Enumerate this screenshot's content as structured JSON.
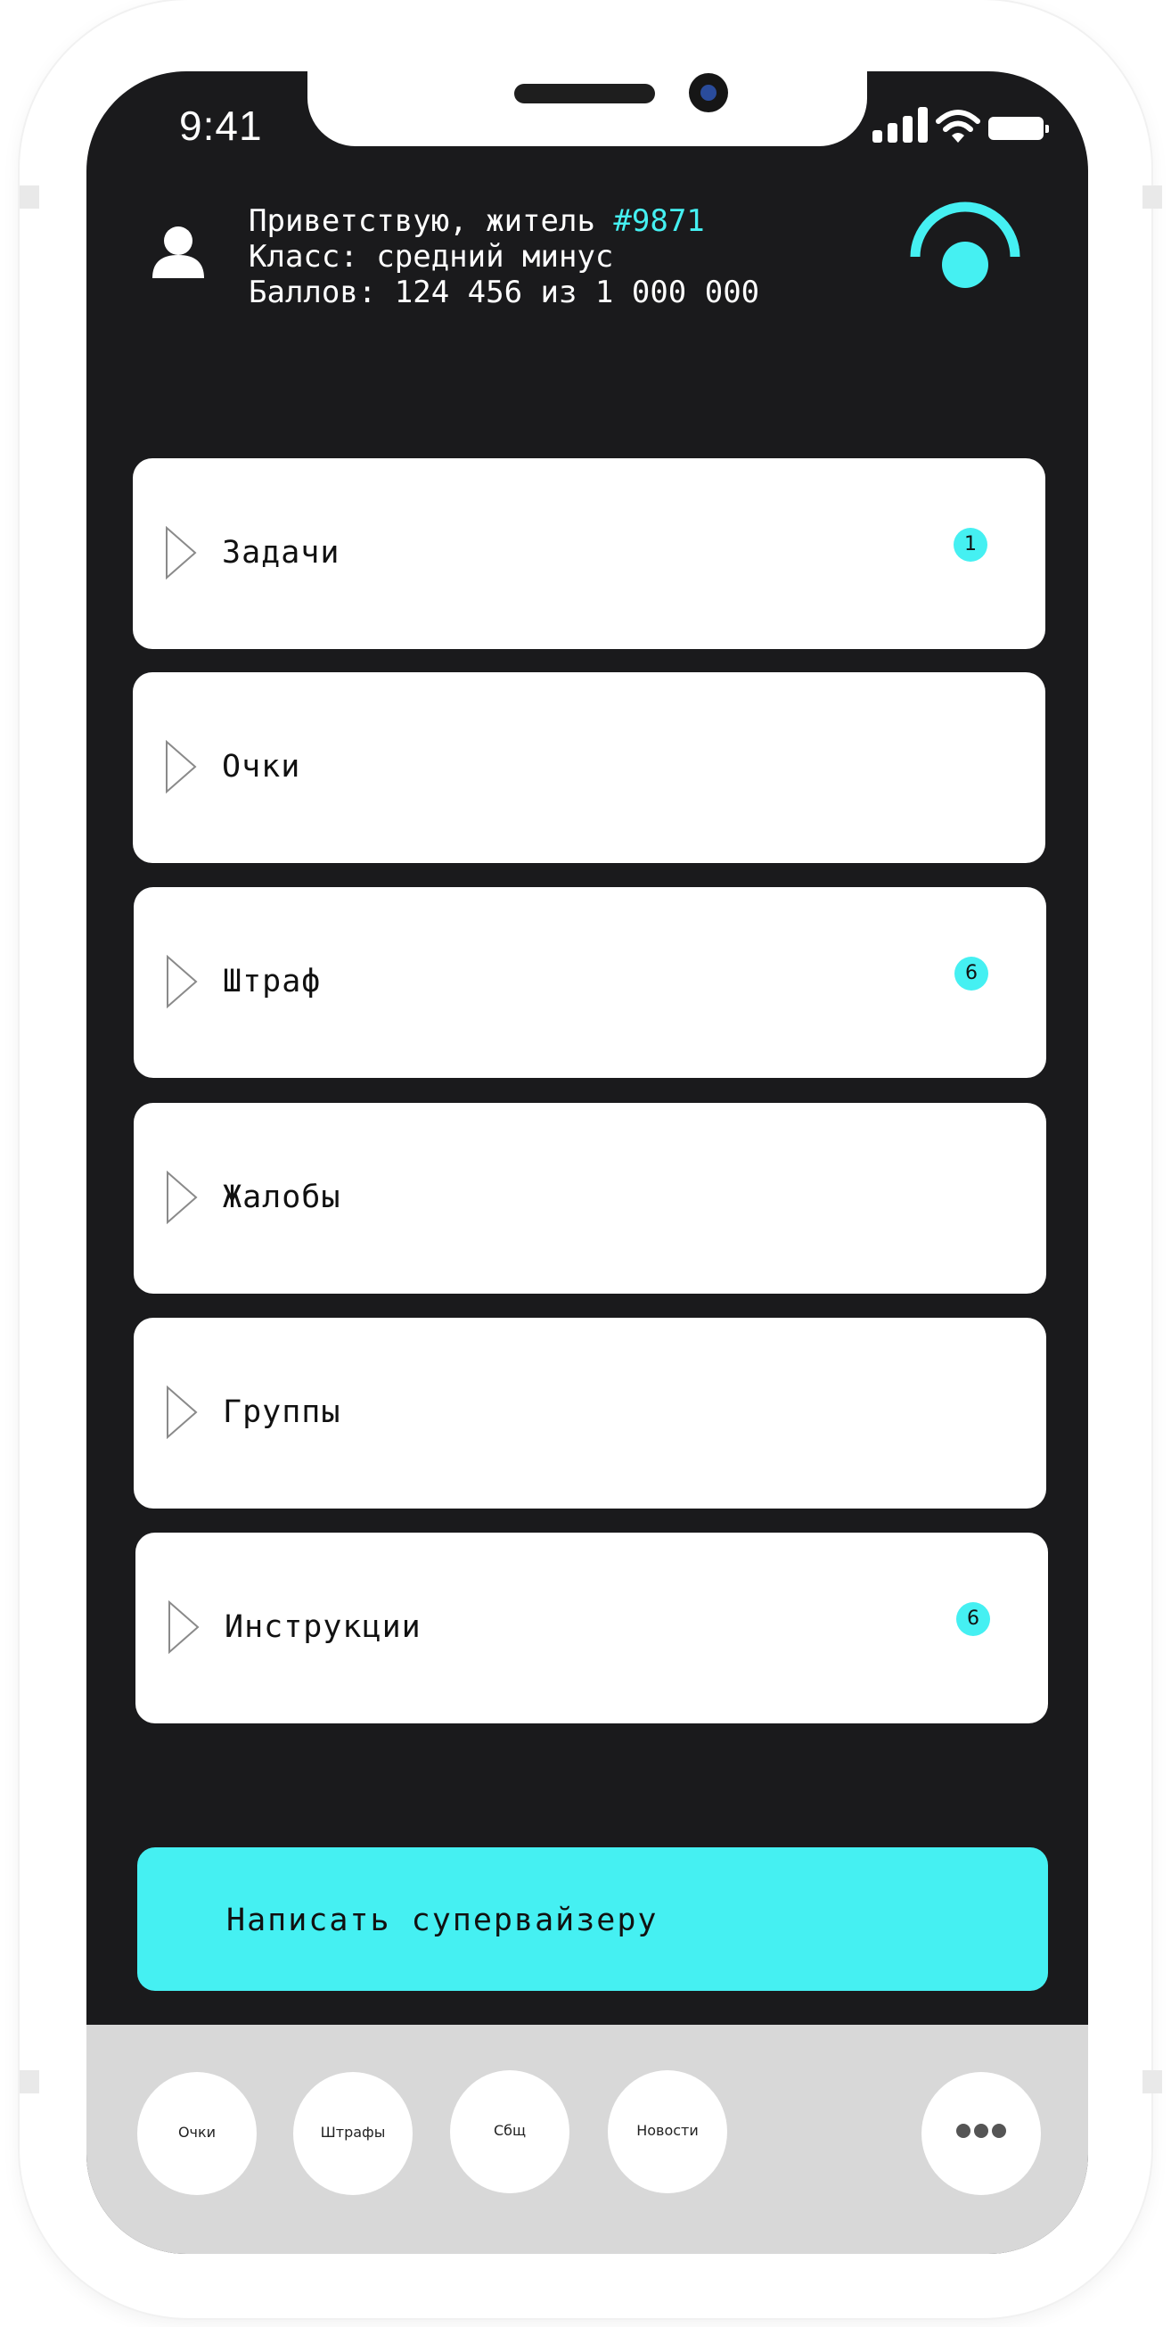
{
  "status": {
    "time": "9:41"
  },
  "header": {
    "greeting_prefix": "Приветствую, житель ",
    "resident_id": "#9871",
    "class_line": "Класс: средний минус",
    "points_line": "Баллов: 124 456 из 1 000 000"
  },
  "menu": {
    "items": [
      {
        "label": "Задачи",
        "badge": "1"
      },
      {
        "label": "Очки",
        "badge": ""
      },
      {
        "label": "Штраф",
        "badge": "6"
      },
      {
        "label": "Жалобы",
        "badge": ""
      },
      {
        "label": "Группы",
        "badge": ""
      },
      {
        "label": "Инструкции",
        "badge": "6"
      }
    ]
  },
  "cta": {
    "label": "Написать супервайзеру"
  },
  "bottom_nav": {
    "tabs": [
      {
        "label": "Очки"
      },
      {
        "label": "Штрафы"
      },
      {
        "label": "Сбщ"
      },
      {
        "label": "Новости"
      }
    ],
    "more_icon": "ellipsis-icon"
  },
  "colors": {
    "accent": "#45f0f2",
    "screen": "#1a1a1c",
    "bar": "#d8d8d8"
  }
}
